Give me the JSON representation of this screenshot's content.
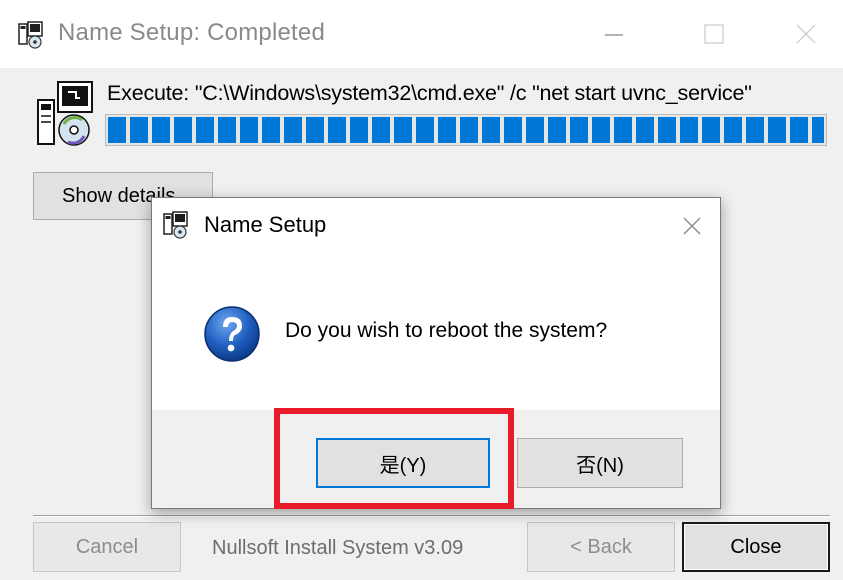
{
  "window": {
    "title": "Name Setup: Completed",
    "icon": "installer-app-icon",
    "minimize_icon": "minimize-icon",
    "maximize_icon": "maximize-icon",
    "close_icon": "close-icon"
  },
  "installer": {
    "status_text": "Execute: \"C:\\Windows\\system32\\cmd.exe\" /c \"net start uvnc_service\"",
    "progress_fraction": 1.0,
    "show_details_label": "Show details",
    "cancel_label": "Cancel",
    "brand_text": "Nullsoft Install System v3.09",
    "back_label": "< Back",
    "close_label": "Close"
  },
  "dialog": {
    "title": "Name Setup",
    "question": "Do you wish to reboot the system?",
    "question_icon": "question-icon",
    "yes_label": "是(Y)",
    "no_label": "否(N)"
  },
  "colors": {
    "accent": "#0078d7",
    "highlight": "#e81b2b",
    "client_bg": "#f0f0f0"
  }
}
